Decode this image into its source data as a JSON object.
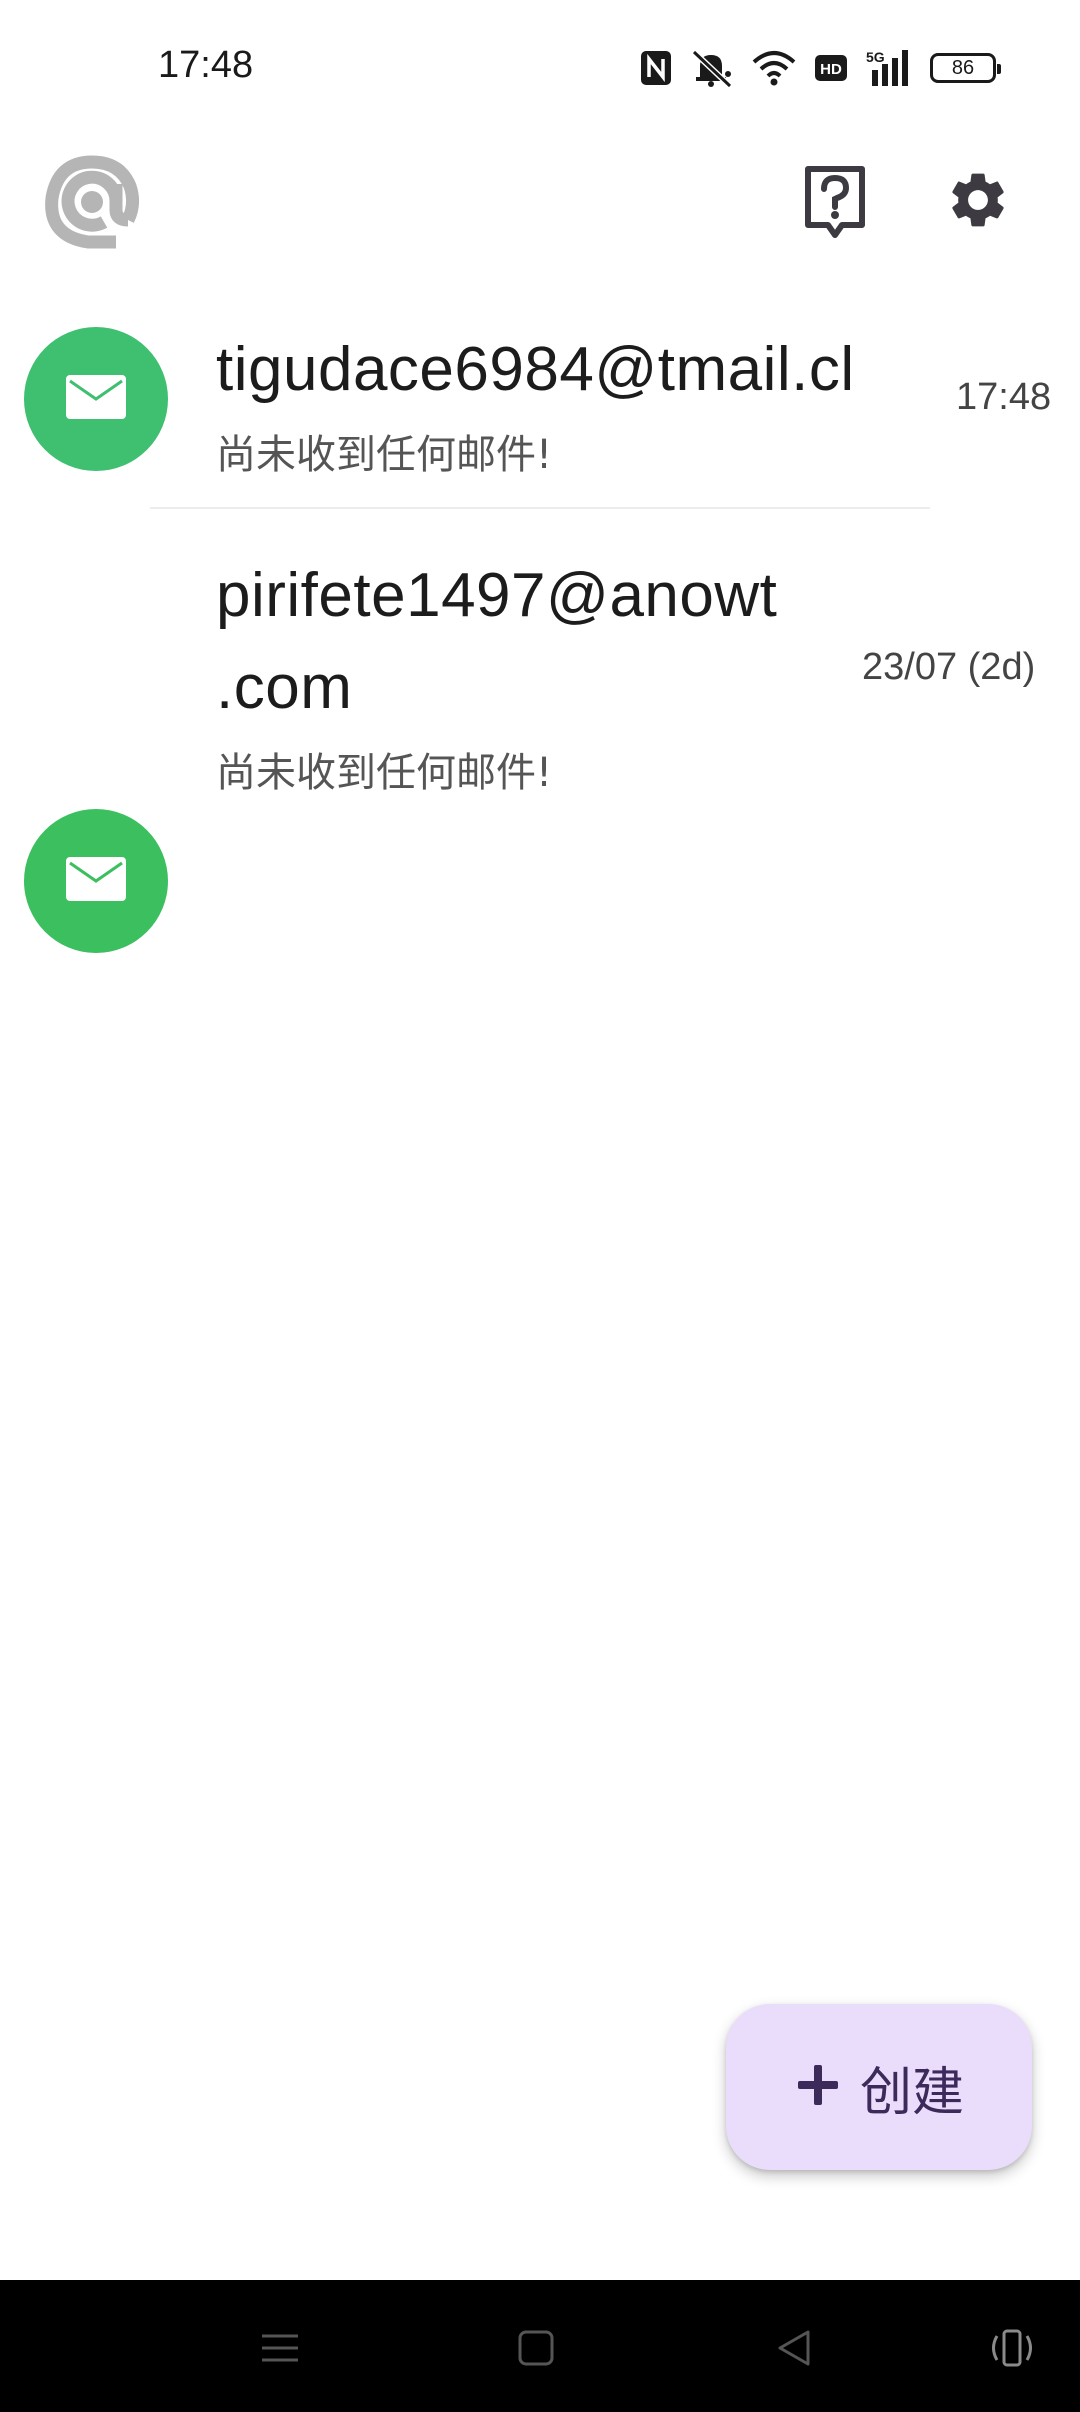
{
  "status_bar": {
    "time": "17:48",
    "battery_level": "86",
    "icons": [
      "nfc-icon",
      "mute-icon",
      "wifi-icon",
      "hd-icon",
      "signal-5g-icon",
      "battery-icon"
    ]
  },
  "app_bar": {
    "logo_icon": "at-sign-icon",
    "help_icon": "help-icon",
    "settings_icon": "gear-icon"
  },
  "inbox": {
    "items": [
      {
        "address_line1": "tigudace6984@tmail.cl",
        "address_line2": "",
        "preview": "尚未收到任何邮件!",
        "timestamp": "17:48",
        "icon": "mail-icon",
        "avatar_color": "#3fbf70"
      },
      {
        "address_line1": "pirifete1497@anowt",
        "address_line2": ".com",
        "preview": "尚未收到任何邮件!",
        "timestamp": "23/07 (2d)",
        "icon": "mail-icon",
        "avatar_color": "#3cbf5f"
      }
    ]
  },
  "fab": {
    "label": "创建",
    "icon": "plus-icon",
    "background": "#eadcfb"
  },
  "nav_bar": {
    "buttons": [
      "menu-icon",
      "home-icon",
      "back-icon",
      "rotate-icon"
    ]
  }
}
